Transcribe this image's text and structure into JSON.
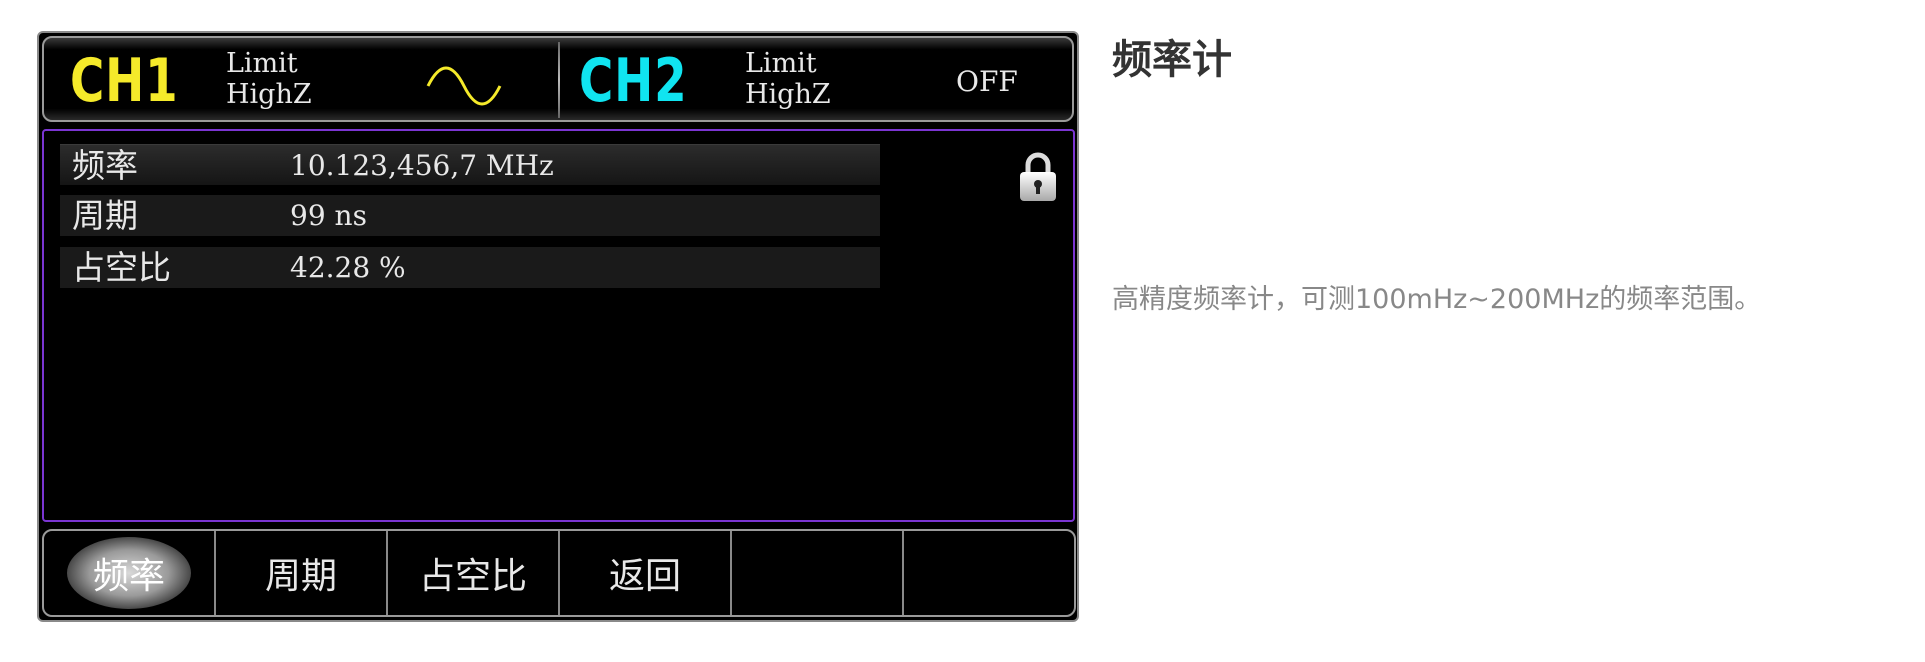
{
  "header": {
    "ch1": {
      "label": "CH1",
      "info_line1": "Limit",
      "info_line2": "HighZ",
      "waveform_icon": "sine-wave-icon"
    },
    "ch2": {
      "label": "CH2",
      "info_line1": "Limit",
      "info_line2": "HighZ",
      "state": "OFF"
    }
  },
  "measurements": [
    {
      "label": "频率",
      "value": "10.123,456,7 MHz"
    },
    {
      "label": "周期",
      "value": "99 ns"
    },
    {
      "label": "占空比",
      "value": "42.28 %"
    }
  ],
  "lock_icon": "lock-icon",
  "softkeys": [
    "频率",
    "周期",
    "占空比",
    "返回",
    "",
    ""
  ],
  "active_softkey": "频率",
  "feature": {
    "title": "频率计",
    "description": "高精度频率计，可测100mHz~200MHz的频率范围。"
  },
  "colors": {
    "ch1": "#f5ea2a",
    "ch2": "#10e4f0",
    "content_border": "#7b35d2"
  }
}
